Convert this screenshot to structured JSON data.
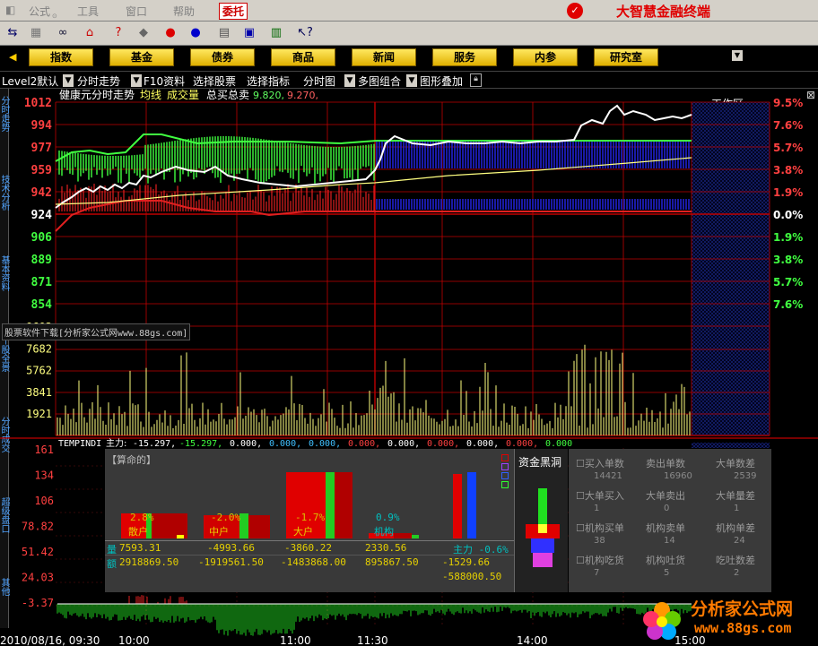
{
  "menu": {
    "items": [
      "公式",
      "工具",
      "窗口",
      "帮助",
      "委托"
    ],
    "brand": "大智慧金融终端"
  },
  "toolbar": {
    "icons": [
      "connect-icon",
      "grid-icon",
      "binoculars-icon",
      "alarm-icon",
      "question-icon",
      "diamond-icon",
      "red-circle-icon",
      "blue-circle-icon",
      "print-icon",
      "window-icon",
      "books-icon",
      "help-cursor-icon"
    ]
  },
  "nav": {
    "buttons": [
      "指数",
      "基金",
      "债券",
      "商品",
      "新闻",
      "服务",
      "内参",
      "研究室"
    ],
    "workarea": "工作区"
  },
  "subtabs": [
    "Level2默认",
    "分时走势",
    "F10资料",
    "选择股票",
    "选择指标",
    "分时图",
    "多图组合",
    "图形叠加"
  ],
  "left_tabs": [
    "分时走势",
    "技术分析",
    "基本资料",
    "个股全景",
    "分时成交",
    "超级盘口",
    "其他"
  ],
  "chart_header": {
    "name": "健康元分时走势",
    "avg_label": "均线",
    "vol_label": "成交量",
    "buy_sell_label": "总买总卖",
    "buy_value": "9.820,",
    "sell_value": "9.270,"
  },
  "price_axis": {
    "left": [
      "1012",
      "994",
      "977",
      "959",
      "942",
      "924",
      "906",
      "889",
      "871",
      "854"
    ],
    "right": [
      "9.5%",
      "7.6%",
      "5.7%",
      "3.8%",
      "1.9%",
      "0.0%",
      "1.9%",
      "3.8%",
      "5.7%",
      "7.6%"
    ]
  },
  "volume_axis": [
    "9603",
    "7682",
    "5762",
    "3841",
    "1921"
  ],
  "watermark": "股票软件下载[分析家公式网www.88gs.com]",
  "indicator": {
    "name": "TEMPINDI",
    "main_label": "主力:",
    "main_value": "-15.297,",
    "values": [
      "-15.297,",
      "0.000,",
      "0.000,",
      "0.000,",
      "0.000,",
      "0.000,",
      "0.000,",
      "0.000,",
      "0.000,",
      "0.000"
    ],
    "axis": [
      "161",
      "134",
      "106",
      "78.82",
      "51.42",
      "24.03",
      "-3.37"
    ]
  },
  "panel": {
    "title": "【算命的】",
    "groups": [
      {
        "pct": "2.8%",
        "name": "散户"
      },
      {
        "pct": "-2.0%",
        "name": "中户"
      },
      {
        "pct": "-1.7%",
        "name": "大户"
      },
      {
        "pct": "0.9%",
        "name": "机构"
      }
    ],
    "zhuli": "主力 -0.6%",
    "row1_label": "量",
    "row1": [
      "7593.31",
      "-4993.66",
      "-3860.22",
      "2330.56"
    ],
    "row2_label": "额",
    "row2": [
      "2918869.50",
      "-1919561.50",
      "-1483868.00",
      "895867.50"
    ],
    "zhuli_vol": "-1529.66",
    "zhuli_amt": "-588000.50"
  },
  "capital_hole": "资金黑洞",
  "stats": [
    {
      "label": "☐买入单数",
      "value": "14421"
    },
    {
      "label": "卖出单数",
      "value": "16960"
    },
    {
      "label": "大单数差",
      "value": "2539"
    },
    {
      "label": "☐大单买入",
      "value": "1"
    },
    {
      "label": "大单卖出",
      "value": "0"
    },
    {
      "label": "大单量差",
      "value": "1"
    },
    {
      "label": "☐机构买单",
      "value": "38"
    },
    {
      "label": "机构卖单",
      "value": "14"
    },
    {
      "label": "机构单差",
      "value": "24"
    },
    {
      "label": "☐机构吃货",
      "value": "7"
    },
    {
      "label": "机构吐货",
      "value": "5"
    },
    {
      "label": "吃吐数差",
      "value": "2"
    }
  ],
  "time_axis": [
    "2010/08/16, 09:30",
    "10:00",
    "11:00",
    "11:30",
    "14:00",
    "15:00"
  ],
  "logo": {
    "text": "分析家公式网",
    "url": "www.88gs.com"
  },
  "colors": {
    "grid": "#c00000",
    "price": "#ffffff",
    "avg": "#ffff80",
    "up": "#ff3030",
    "down": "#40ff40",
    "blue": "#2020ff",
    "axis_up": "#ff4040",
    "axis_down": "#40ff40",
    "volume": "#ffff80"
  }
}
